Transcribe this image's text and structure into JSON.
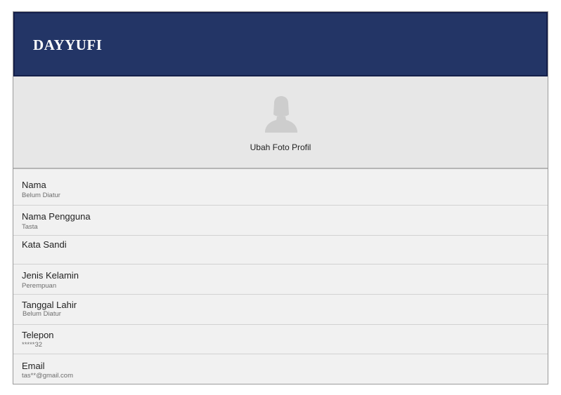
{
  "header": {
    "title": "DAYYUFI"
  },
  "profile_photo": {
    "avatar_icon": "user-silhouette-icon",
    "change_label": "Ubah Foto Profil"
  },
  "fields": [
    {
      "label": "Nama",
      "value": "Belum Diatur"
    },
    {
      "label": "Nama Pengguna",
      "value": "Tasta"
    },
    {
      "label": "Kata Sandi",
      "value": ""
    },
    {
      "label": "Jenis Kelamin",
      "value": "Perempuan"
    },
    {
      "label": "Tanggal Lahir",
      "value": "Belum Diatur"
    },
    {
      "label": "Telepon",
      "value": "*****32"
    },
    {
      "label": "Email",
      "value": "tas**@gmail.com"
    }
  ],
  "colors": {
    "header_bg": "#233566",
    "photo_bg": "#e7e7e7",
    "list_bg": "#f1f1f1"
  }
}
